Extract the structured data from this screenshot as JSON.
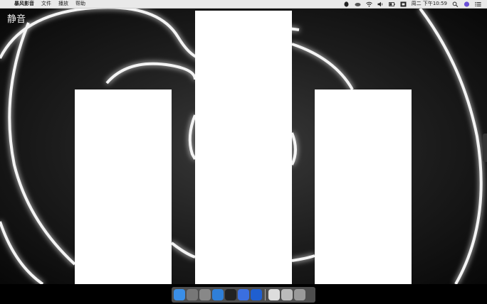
{
  "menubar": {
    "apple": "",
    "app_name": "暴风影音",
    "menus": [
      "文件",
      "播放",
      "帮助"
    ],
    "clock": "周二 下午10:59"
  },
  "window": {
    "title": "静音"
  },
  "dock": {
    "apps": [
      {
        "name": "finder-icon",
        "color": "#3a8ee6"
      },
      {
        "name": "launchpad-icon",
        "color": "#777777"
      },
      {
        "name": "system-preferences-icon",
        "color": "#888888"
      },
      {
        "name": "safari-icon",
        "color": "#2f7fd8"
      },
      {
        "name": "qq-icon",
        "color": "#222222"
      },
      {
        "name": "baidu-netdisk-icon",
        "color": "#3b6fe0"
      },
      {
        "name": "baofeng-icon",
        "color": "#1f5fd0"
      },
      {
        "name": "document-icon",
        "color": "#dddddd"
      },
      {
        "name": "preview-icon",
        "color": "#bbbbbb"
      },
      {
        "name": "trash-icon",
        "color": "#9a9a9a"
      }
    ]
  }
}
